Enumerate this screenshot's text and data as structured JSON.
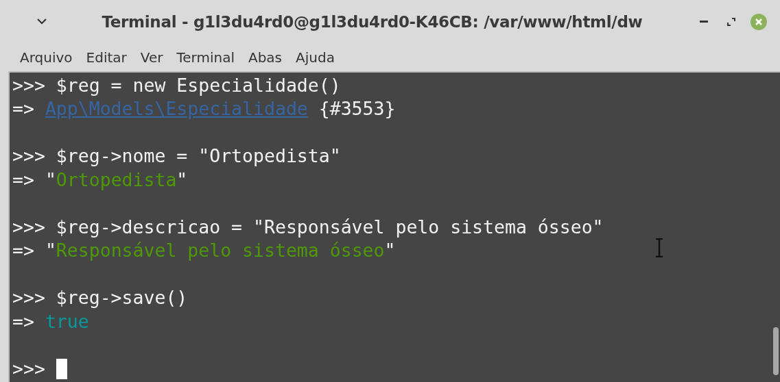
{
  "window": {
    "title": "Terminal - g1l3du4rd0@g1l3du4rd0-K46CB: /var/www/html/dw"
  },
  "menu": [
    {
      "label": "Arquivo"
    },
    {
      "label": "Editar"
    },
    {
      "label": "Ver"
    },
    {
      "label": "Terminal"
    },
    {
      "label": "Abas"
    },
    {
      "label": "Ajuda"
    }
  ],
  "terminal": {
    "entries": [
      {
        "prompt": ">>>",
        "command": "$reg = new Especialidade()",
        "arrow": "=>",
        "result": [
          {
            "kind": "link",
            "text": "App\\Models\\Especialidade"
          },
          {
            "kind": "plain",
            "text": "{#3553}"
          }
        ]
      },
      {
        "prompt": ">>>",
        "command": "$reg->nome = \"Ortopedista\"",
        "arrow": "=>",
        "result": [
          {
            "kind": "quote",
            "text": "\""
          },
          {
            "kind": "string",
            "text": "Ortopedista"
          },
          {
            "kind": "quote",
            "text": "\""
          }
        ]
      },
      {
        "prompt": ">>>",
        "command": "$reg->descricao = \"Responsável pelo sistema ósseo\"",
        "arrow": "=>",
        "result": [
          {
            "kind": "quote",
            "text": "\""
          },
          {
            "kind": "string",
            "text": "Responsável pelo sistema ósseo"
          },
          {
            "kind": "quote",
            "text": "\""
          }
        ]
      },
      {
        "prompt": ">>>",
        "command": "$reg->save()",
        "arrow": "=>",
        "result": [
          {
            "kind": "bool",
            "text": "true"
          }
        ]
      }
    ],
    "current_prompt": ">>>"
  }
}
